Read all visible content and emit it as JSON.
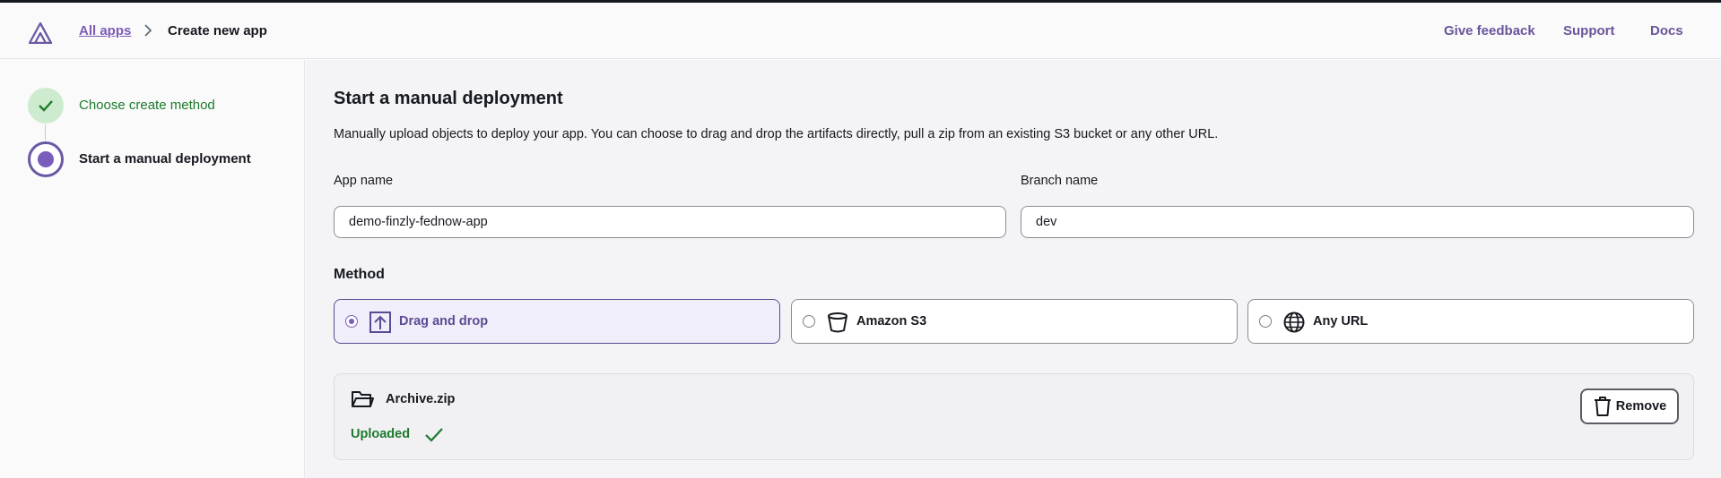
{
  "header": {
    "breadcrumb": {
      "parent": "All apps",
      "current": "Create new app"
    },
    "links": {
      "feedback": "Give feedback",
      "support": "Support",
      "docs": "Docs"
    }
  },
  "sidebar": {
    "steps": [
      {
        "label": "Choose create method",
        "status": "complete",
        "icon": "check-icon"
      },
      {
        "label": "Start a manual deployment",
        "status": "current",
        "icon": "current-step-dot"
      }
    ]
  },
  "main": {
    "title": "Start a manual deployment",
    "description": "Manually upload objects to deploy your app. You can choose to drag and drop the artifacts directly, pull a zip from an existing S3 bucket or any other URL.",
    "app_name": {
      "label": "App name",
      "value": "demo-finzly-fednow-app"
    },
    "branch_name": {
      "label": "Branch name",
      "value": "dev"
    },
    "method": {
      "label": "Method",
      "options": [
        {
          "label": "Drag and drop",
          "icon": "upload-icon",
          "selected": true
        },
        {
          "label": "Amazon S3",
          "icon": "bucket-icon",
          "selected": false
        },
        {
          "label": "Any URL",
          "icon": "globe-icon",
          "selected": false
        }
      ]
    },
    "file": {
      "name": "Archive.zip",
      "status": "Uploaded",
      "remove_label": "Remove"
    }
  },
  "colors": {
    "accent": "#7a5cbc",
    "link": "#6a559c",
    "success": "#1d7a2d",
    "success_bg": "#cdeccf"
  }
}
